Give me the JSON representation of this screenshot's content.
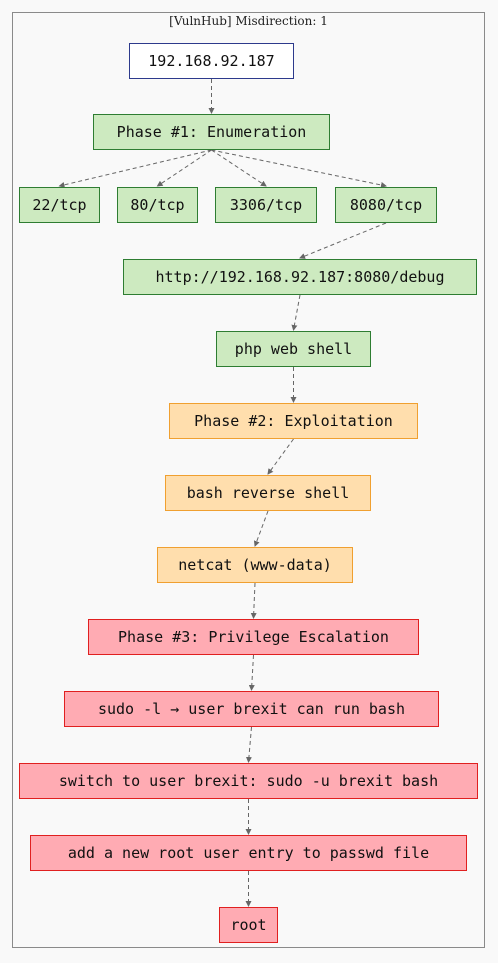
{
  "diagram": {
    "title": "[VulnHub] Misdirection: 1",
    "colors": {
      "target_fill": "#ffffff",
      "target_border": "#2d3a8c",
      "enumeration_fill": "#cdeac0",
      "enumeration_border": "#2e7d32",
      "exploitation_fill": "#ffdead",
      "exploitation_border": "#f0a030",
      "privesc_fill": "#ffabb3",
      "privesc_border": "#e02020",
      "edge": "#666666"
    },
    "nodes": [
      {
        "id": "ip",
        "label": "192.168.92.187",
        "group": "target"
      },
      {
        "id": "phase1",
        "label": "Phase #1: Enumeration",
        "group": "enumeration"
      },
      {
        "id": "p22",
        "label": "22/tcp",
        "group": "enumeration"
      },
      {
        "id": "p80",
        "label": "80/tcp",
        "group": "enumeration"
      },
      {
        "id": "p3306",
        "label": "3306/tcp",
        "group": "enumeration"
      },
      {
        "id": "p8080",
        "label": "8080/tcp",
        "group": "enumeration"
      },
      {
        "id": "debug",
        "label": "http://192.168.92.187:8080/debug",
        "group": "enumeration"
      },
      {
        "id": "webshell",
        "label": "php web shell",
        "group": "enumeration"
      },
      {
        "id": "phase2",
        "label": "Phase #2: Exploitation",
        "group": "exploitation"
      },
      {
        "id": "revshell",
        "label": "bash reverse shell",
        "group": "exploitation"
      },
      {
        "id": "netcat",
        "label": "netcat (www-data)",
        "group": "exploitation"
      },
      {
        "id": "phase3",
        "label": "Phase #3: Privilege Escalation",
        "group": "privesc"
      },
      {
        "id": "sudo",
        "label": "sudo -l → user brexit can run bash",
        "group": "privesc"
      },
      {
        "id": "switch",
        "label": "switch to user brexit: sudo -u brexit bash",
        "group": "privesc"
      },
      {
        "id": "passwd",
        "label": "add a new root user entry to passwd file",
        "group": "privesc"
      },
      {
        "id": "root",
        "label": "root",
        "group": "privesc"
      }
    ],
    "edges": [
      [
        "ip",
        "phase1"
      ],
      [
        "phase1",
        "p22"
      ],
      [
        "phase1",
        "p80"
      ],
      [
        "phase1",
        "p3306"
      ],
      [
        "phase1",
        "p8080"
      ],
      [
        "p8080",
        "debug"
      ],
      [
        "debug",
        "webshell"
      ],
      [
        "webshell",
        "phase2"
      ],
      [
        "phase2",
        "revshell"
      ],
      [
        "revshell",
        "netcat"
      ],
      [
        "netcat",
        "phase3"
      ],
      [
        "phase3",
        "sudo"
      ],
      [
        "sudo",
        "switch"
      ],
      [
        "switch",
        "passwd"
      ],
      [
        "passwd",
        "root"
      ]
    ]
  }
}
